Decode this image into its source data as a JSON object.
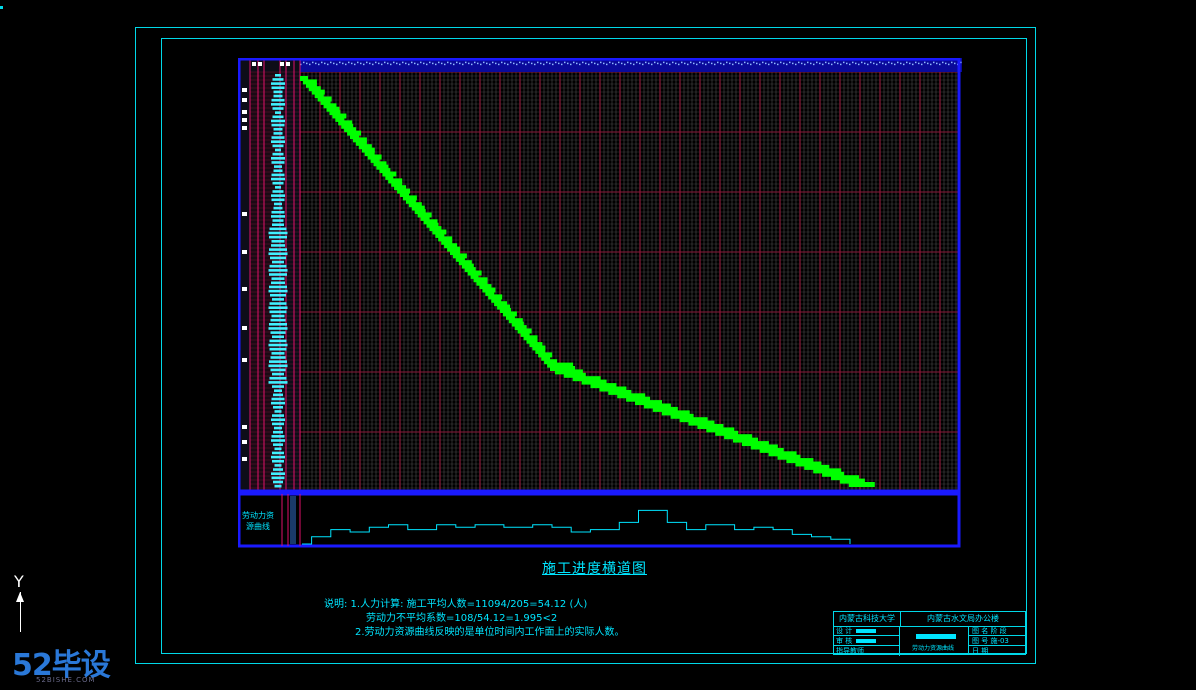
{
  "drawing": {
    "title": "施工进度横道图",
    "notes": {
      "line1": "说明: 1.人力计算: 施工平均人数=11094/205=54.12 (人)",
      "line2": "劳动力不平均系数=108/54.12=1.995<2",
      "line3": "2.劳动力资源曲线反映的是单位时间内工作面上的实际人数。"
    },
    "resource_label": "劳动力资源曲线",
    "title_block": {
      "school": "内蒙古科技大学",
      "project": "内蒙古水文局办公楼",
      "drawing_name": "劳动力资源曲线",
      "rows_left": [
        "设 计",
        "审 核",
        "指导教师"
      ],
      "rows_right": [
        "图 名  阶 段",
        "图 号  施-03",
        "日 期"
      ]
    }
  },
  "colors": {
    "background": "#000000",
    "frame": "#00d8e8",
    "chart_border": "#1a1aff",
    "grid_red": "#8b1a3a",
    "grid_white": "#c8c8c8",
    "progress_bar": "#00ff00",
    "resource_line": "#00e5ff",
    "text": "#00e5ff"
  },
  "chart_data": {
    "type": "bar",
    "title": "",
    "resource_profile": [
      0,
      3,
      3,
      6,
      6,
      5,
      5,
      7,
      7,
      8,
      8,
      6,
      6,
      6,
      8,
      8,
      7,
      7,
      8,
      8,
      8,
      7,
      7,
      7,
      8,
      8,
      7,
      7,
      5,
      5,
      6,
      6,
      6,
      9,
      9,
      14,
      14,
      14,
      9,
      9,
      6,
      6,
      8,
      8,
      8,
      6,
      6,
      7,
      7,
      6,
      6,
      4,
      4,
      3,
      3,
      2,
      2
    ]
  },
  "watermark": {
    "logo": "52毕设",
    "sub": "52BISHE.COM"
  },
  "axis_label": "Y"
}
